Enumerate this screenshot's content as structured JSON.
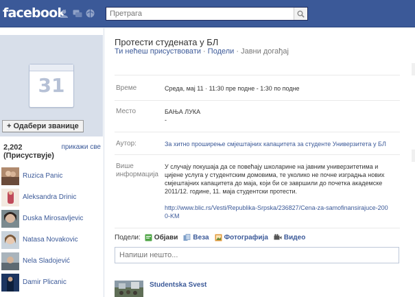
{
  "topbar": {
    "logo": "facebook",
    "search_placeholder": "Претрага",
    "jewels": [
      "friend-requests-icon",
      "messages-icon",
      "notifications-icon"
    ],
    "colors": {
      "bar": "#3b5998",
      "link": "#3b5998"
    }
  },
  "sidebar": {
    "calendar_day": "31",
    "choose_button": "+ Одабери званице",
    "attendee_count": "2,202",
    "attendee_label": "(Присуствује)",
    "show_all": "прикажи све",
    "people": [
      {
        "name": "Ruzica Panic"
      },
      {
        "name": "Aleksandra Drinic"
      },
      {
        "name": "Duska Mirosavljevic"
      },
      {
        "name": "Natasa Novakovic"
      },
      {
        "name": "Nela Sladojević"
      },
      {
        "name": "Damir Plicanic"
      }
    ]
  },
  "event": {
    "title": "Протести студената у БЛ",
    "rsvp_status": "Ти нећеш присуствовати",
    "sep": " · ",
    "share_link": "Подели",
    "visibility": "Јавни догађај",
    "details": {
      "time_label": "Време",
      "time_value": "Среда, мај 11 · 11:30 пре подне - 1:30 по подне",
      "place_label": "Место",
      "place_value": "БАЊА ЛУКА",
      "place_sub": "-",
      "author_label": "Аутор:",
      "author_value": "За хитно проширење смјештајних капацитета за студенте Универзитета у БЛ",
      "more_label_1": "Више",
      "more_label_2": "информација",
      "more_lines": [
        "У случају покушаја да се повећају школарине на јавним универзитетима и",
        "цијене услуга у студентским домовима, те уколико не почне изградња нових",
        "смјештајних капацитета до маја, који би се завршили до почетка академске",
        "2011/12. године, 11. маја студентски протести."
      ],
      "more_link_1": "http://www.blic.rs/Vesti/Republika-Srpska/236827/Cena-za-samofinansirajuce-200",
      "more_link_2": "0-KM"
    },
    "share": {
      "label": "Подели:",
      "items": [
        {
          "label": "Објави",
          "icon": "status-icon"
        },
        {
          "label": "Веза",
          "icon": "link-icon"
        },
        {
          "label": "Фотографија",
          "icon": "photo-icon"
        },
        {
          "label": "Видео",
          "icon": "video-icon"
        }
      ],
      "composer_placeholder": "Напиши нешто..."
    },
    "post": {
      "author": "Studentska Svest"
    }
  }
}
